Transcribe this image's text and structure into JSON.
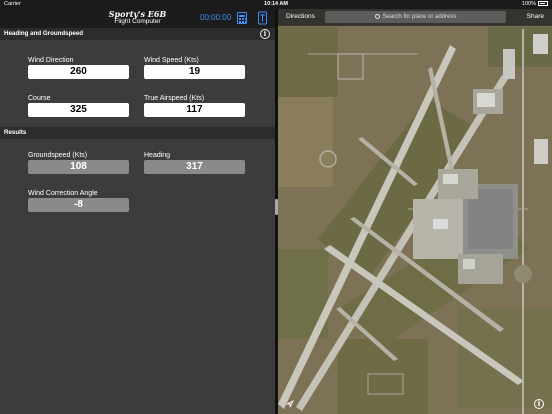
{
  "status_bar": {
    "carrier": "Carrier",
    "time": "10:14 AM",
    "battery": "100%"
  },
  "header": {
    "title": "Sporty's E6B",
    "subtitle": "Flight Computer",
    "timer": "00:00:00"
  },
  "sections": {
    "inputs_title": "Heading and Groundspeed",
    "results_title": "Results"
  },
  "inputs": [
    {
      "label": "Wind Direction",
      "value": "260"
    },
    {
      "label": "Wind Speed (Kts)",
      "value": "19"
    },
    {
      "label": "Course",
      "value": "325"
    },
    {
      "label": "True Airspeed (Kts)",
      "value": "117"
    }
  ],
  "results": [
    {
      "label": "Groundspeed (Kts)",
      "value": "108"
    },
    {
      "label": "Heading",
      "value": "317"
    },
    {
      "label": "Wind Correction Angle",
      "value": "-8"
    }
  ],
  "map": {
    "directions_label": "Directions",
    "search_placeholder": "Search for place or address",
    "share_label": "Share"
  },
  "colors": {
    "accent": "#3a8ef5",
    "input_bg": "#ffffff",
    "output_bg": "#8a8a8a",
    "panel_bg": "#3c3c3c"
  }
}
